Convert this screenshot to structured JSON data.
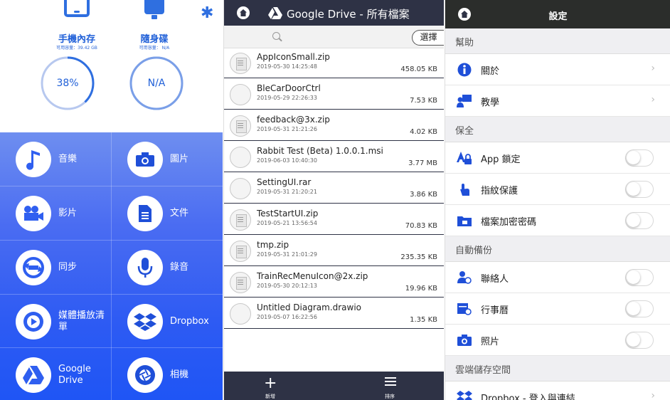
{
  "home": {
    "settings_icon": "gear-icon",
    "storage": [
      {
        "title": "手機內存",
        "sub": "可用容量：39.42 GB",
        "ring": "38%",
        "fraction": 0.38
      },
      {
        "title": "隨身碟",
        "sub": "可用容量： N/A",
        "ring": "N/A",
        "fraction": 1.0
      }
    ],
    "menu": [
      {
        "label": "音樂",
        "icon": "music-note-icon"
      },
      {
        "label": "圖片",
        "icon": "camera-icon"
      },
      {
        "label": "影片",
        "icon": "video-camera-icon"
      },
      {
        "label": "文件",
        "icon": "document-icon"
      },
      {
        "label": "同步",
        "icon": "sync-icon"
      },
      {
        "label": "錄音",
        "icon": "microphone-icon"
      },
      {
        "label": "媒體播放清單",
        "icon": "playlist-icon"
      },
      {
        "label": "Dropbox",
        "icon": "dropbox-icon"
      },
      {
        "label": "Google Drive",
        "icon": "google-drive-icon"
      },
      {
        "label": "相機",
        "icon": "camera-shutter-icon"
      }
    ]
  },
  "drive": {
    "title": "Google Drive - 所有檔案",
    "select_label": "選擇",
    "files": [
      {
        "name": "AppIconSmall.zip",
        "date": "2019-05-30 14:25:48",
        "size": "458.05 KB",
        "type": "zip"
      },
      {
        "name": "BleCarDoorCtrl",
        "date": "2019-05-29 22:26:33",
        "size": "7.53 KB",
        "type": "file"
      },
      {
        "name": "feedback@3x.zip",
        "date": "2019-05-31 21:21:26",
        "size": "4.02 KB",
        "type": "zip"
      },
      {
        "name": "Rabbit Test (Beta) 1.0.0.1.msi",
        "date": "2019-06-03 10:40:30",
        "size": "3.77 MB",
        "type": "file"
      },
      {
        "name": "SettingUI.rar",
        "date": "2019-05-31 21:20:21",
        "size": "3.86 KB",
        "type": "file"
      },
      {
        "name": "TestStartUI.zip",
        "date": "2019-05-21 13:56:54",
        "size": "70.83 KB",
        "type": "zip"
      },
      {
        "name": "tmp.zip",
        "date": "2019-05-31 21:01:29",
        "size": "235.35 KB",
        "type": "zip"
      },
      {
        "name": "TrainRecMenuIcon@2x.zip",
        "date": "2019-05-30 20:12:13",
        "size": "19.96 KB",
        "type": "zip"
      },
      {
        "name": "Untitled Diagram.drawio",
        "date": "2019-05-07 16:22:56",
        "size": "1.35 KB",
        "type": "file"
      }
    ],
    "footer": {
      "new_label": "新增",
      "sort_label": "排序"
    }
  },
  "settings": {
    "title": "設定",
    "sections": {
      "help": "幫助",
      "security": "保全",
      "backup": "自動備份",
      "cloud": "雲端儲存空間"
    },
    "rows": {
      "about": "關於",
      "tutorial": "教學",
      "app_lock": "App 鎖定",
      "fingerprint": "指紋保護",
      "encrypt": "檔案加密密碼",
      "contacts": "聯絡人",
      "calendar": "行事曆",
      "photos": "照片",
      "dropbox": "Dropbox - 登入與連結"
    },
    "toggles": {
      "app_lock": false,
      "fingerprint": false,
      "encrypt": false,
      "contacts": false,
      "calendar": false,
      "photos": false
    },
    "colors": {
      "accent": "#1f4fd8",
      "header": "#2b2d2b"
    }
  }
}
